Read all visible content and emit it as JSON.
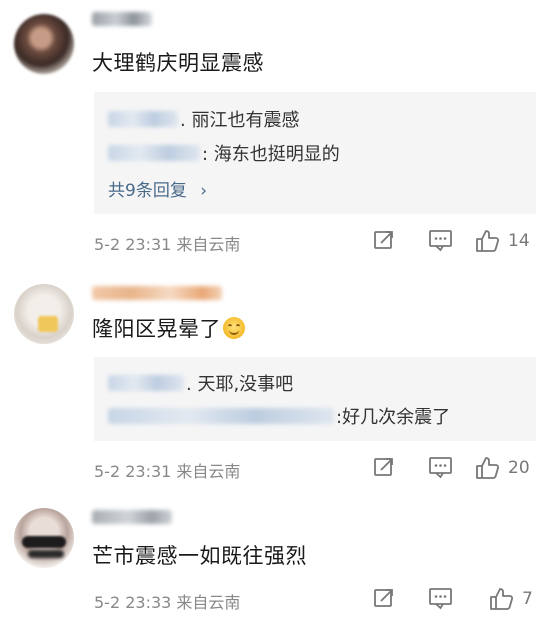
{
  "comments": [
    {
      "text": "大理鹤庆明显震感",
      "replies": [
        {
          "text": ". 丽江也有震感"
        },
        {
          "text": ": 海东也挺明显的"
        }
      ],
      "more_label": "共9条回复",
      "more_icon": "chevron-right-icon",
      "meta": "5-2 23:31  来自云南",
      "likes": "14"
    },
    {
      "text": "隆阳区晃晕了",
      "emoji": "dizzy-face-emoji",
      "replies": [
        {
          "text": ". 天耶,没事吧"
        },
        {
          "text": ":好几次余震了"
        }
      ],
      "meta": "5-2 23:31  来自云南",
      "likes": "20"
    },
    {
      "text": "芒市震感一如既往强烈",
      "meta": "5-2 23:33  来自云南",
      "likes": "7"
    }
  ],
  "icons": {
    "share": "share-icon",
    "comment": "comment-icon",
    "like": "like-icon"
  },
  "colors": {
    "reply_bg": "#f5f5f5",
    "link": "#4a6a8a",
    "meta": "#888888"
  }
}
